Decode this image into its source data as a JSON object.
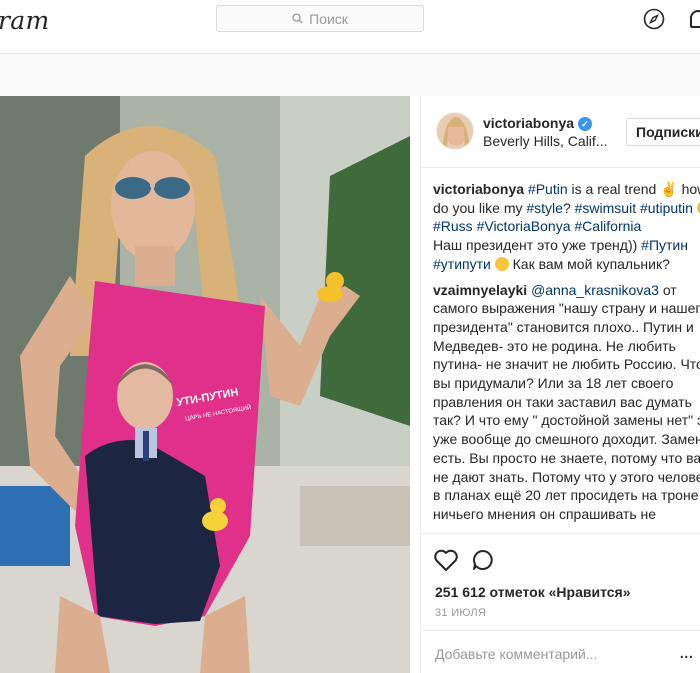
{
  "app": {
    "logo": "ram"
  },
  "search": {
    "placeholder": "Поиск"
  },
  "post": {
    "author": {
      "username": "victoriabonya",
      "location": "Beverly Hills, Calif...",
      "follow_label": "Подписки"
    },
    "caption": {
      "username": "victoriabonya",
      "line1": "is a real trend",
      "hashtags": [
        "#Putin",
        "#style",
        "#swimsuit",
        "#utiputin",
        "#Russ",
        "#VictoriaBonya",
        "#California",
        "#Путин",
        "#утипути"
      ],
      "text_how": "how do you like my",
      "text_ru": "Наш президент это уже тренд))",
      "text_ru2": "Как вам мой купальник?"
    },
    "comment": {
      "username": "vzaimnyelayki",
      "mention": "@anna_krasnikova3",
      "text": "от самого выражения \"нашу страну и нашего президента\" становится плохо.. Путин и Медведев- это не родина. Не любить путина- не значит не любить Россию. Что вы придумали? Или за 18 лет своего правления он таки заставил вас думать так? И что ему \" достойной замены нет\" это уже вообще до смешного доходит. Замена есть. Вы просто не знаете, потому что вам не дают знать. Потому что у этого человека в планах ещё 20 лет просидеть на троне. И ничьего мнения он спрашивать не"
    },
    "likes": "251 612 отметок «Нравится»",
    "date": "31 ИЮЛЯ",
    "add_comment_placeholder": "Добавьте комментарий...",
    "more": "..."
  },
  "photo": {
    "swimsuit_text": "УТИ-ПУТИН",
    "swimsuit_subtext": "ЦАРЬ НЕ НАСТОЯЩИЙ"
  },
  "colors": {
    "link": "#003569",
    "verified": "#3897f0",
    "swimsuit": "#e0308a"
  },
  "icons": [
    "search-icon",
    "compass-icon",
    "profile-icon",
    "verified-icon",
    "heart-icon",
    "comment-icon",
    "more-icon"
  ]
}
